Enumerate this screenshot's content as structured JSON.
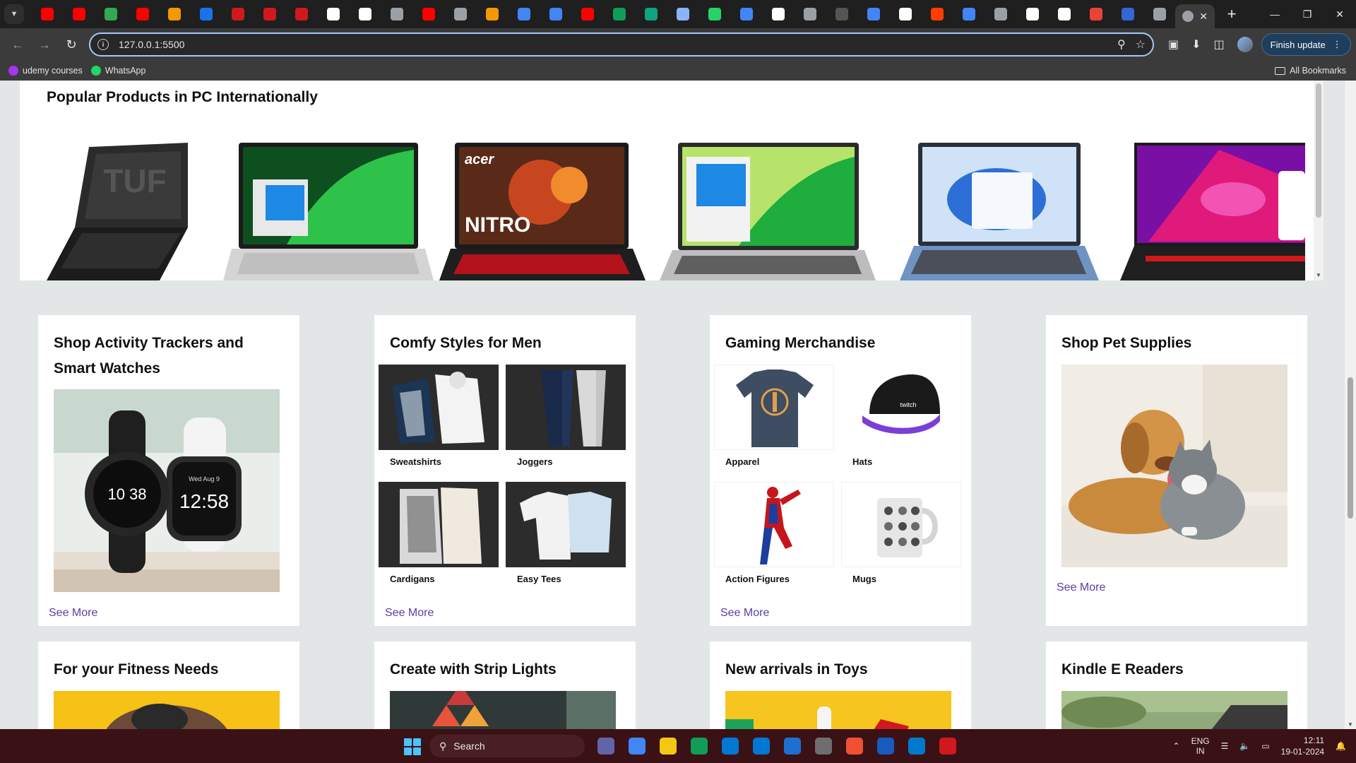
{
  "browser": {
    "pinned_tab_colors": [
      "#ff0000",
      "#ff0000",
      "#34a853",
      "#ff0000",
      "#f29900",
      "#1a73e8",
      "#d0191c",
      "#d0191c",
      "#d0191c",
      "#ffffff",
      "#ffffff",
      "#9aa0a6",
      "#ff0000",
      "#9aa0a6",
      "#f29900",
      "#4285f4",
      "#4285f4",
      "#ff0000",
      "#0f9d58",
      "#10a37f",
      "#8ab4f8",
      "#25d366",
      "#4285f4",
      "#ffffff",
      "#9aa0a6",
      "#555555",
      "#4285f4",
      "#ffffff",
      "#ff3d00",
      "#4285f4",
      "#9aa0a6",
      "#ffffff",
      "#ffffff",
      "#ea4335",
      "#3367d6",
      "#9aa0a6"
    ],
    "url": "127.0.0.1:5500",
    "finish_update_label": "Finish update",
    "bookmarks": [
      {
        "label": "udemy courses",
        "color": "#a435f0"
      },
      {
        "label": "WhatsApp",
        "color": "#25d366"
      }
    ],
    "all_bookmarks_label": "All Bookmarks"
  },
  "page": {
    "pc_section": {
      "title": "Popular Products in PC Internationally",
      "products": [
        {
          "name": "asus-tuf-laptop",
          "screen": "#2a2a2a",
          "accent": "#444"
        },
        {
          "name": "acer-swift-laptop",
          "screen": "#1aa34a",
          "accent": "#c9c9c9"
        },
        {
          "name": "acer-nitro-laptop",
          "screen": "#c8461f",
          "accent": "#d0191c"
        },
        {
          "name": "acer-aspire-laptop",
          "screen": "#3cb44a",
          "accent": "#9a9a9a"
        },
        {
          "name": "windows11-laptop",
          "screen": "#2d6fd6",
          "accent": "#7a9cc5"
        },
        {
          "name": "asus-rog-laptop",
          "screen": "#b2158f",
          "accent": "#d0191c"
        }
      ]
    },
    "cards_row1": [
      {
        "title": "Shop Activity Trackers and Smart Watches",
        "see_more": "See More"
      },
      {
        "title": "Comfy Styles for Men",
        "items": [
          "Sweatshirts",
          "Joggers",
          "Cardigans",
          "Easy Tees"
        ],
        "see_more": "See More"
      },
      {
        "title": "Gaming Merchandise",
        "items": [
          "Apparel",
          "Hats",
          "Action Figures",
          "Mugs"
        ],
        "see_more": "See More"
      },
      {
        "title": "Shop Pet Supplies",
        "see_more": "See More"
      }
    ],
    "cards_row2": [
      {
        "title": "For your Fitness Needs"
      },
      {
        "title": "Create with Strip Lights"
      },
      {
        "title": "New arrivals in Toys"
      },
      {
        "title": "Kindle E Readers"
      }
    ],
    "watch_faces": {
      "left": "10 38",
      "right": "12:58",
      "right_date": "Wed Aug 9"
    }
  },
  "taskbar": {
    "search_placeholder": "Search",
    "app_colors": [
      "#6264a7",
      "#4285f4",
      "#f2c811",
      "#0f9d58",
      "#0078d4",
      "#0078d4",
      "#1f6fd0",
      "#6e6e6e",
      "#f05133",
      "#185abd",
      "#007acc",
      "#d0191c"
    ],
    "language": "ENG",
    "region": "IN",
    "time": "12:11",
    "date": "19-01-2024"
  }
}
